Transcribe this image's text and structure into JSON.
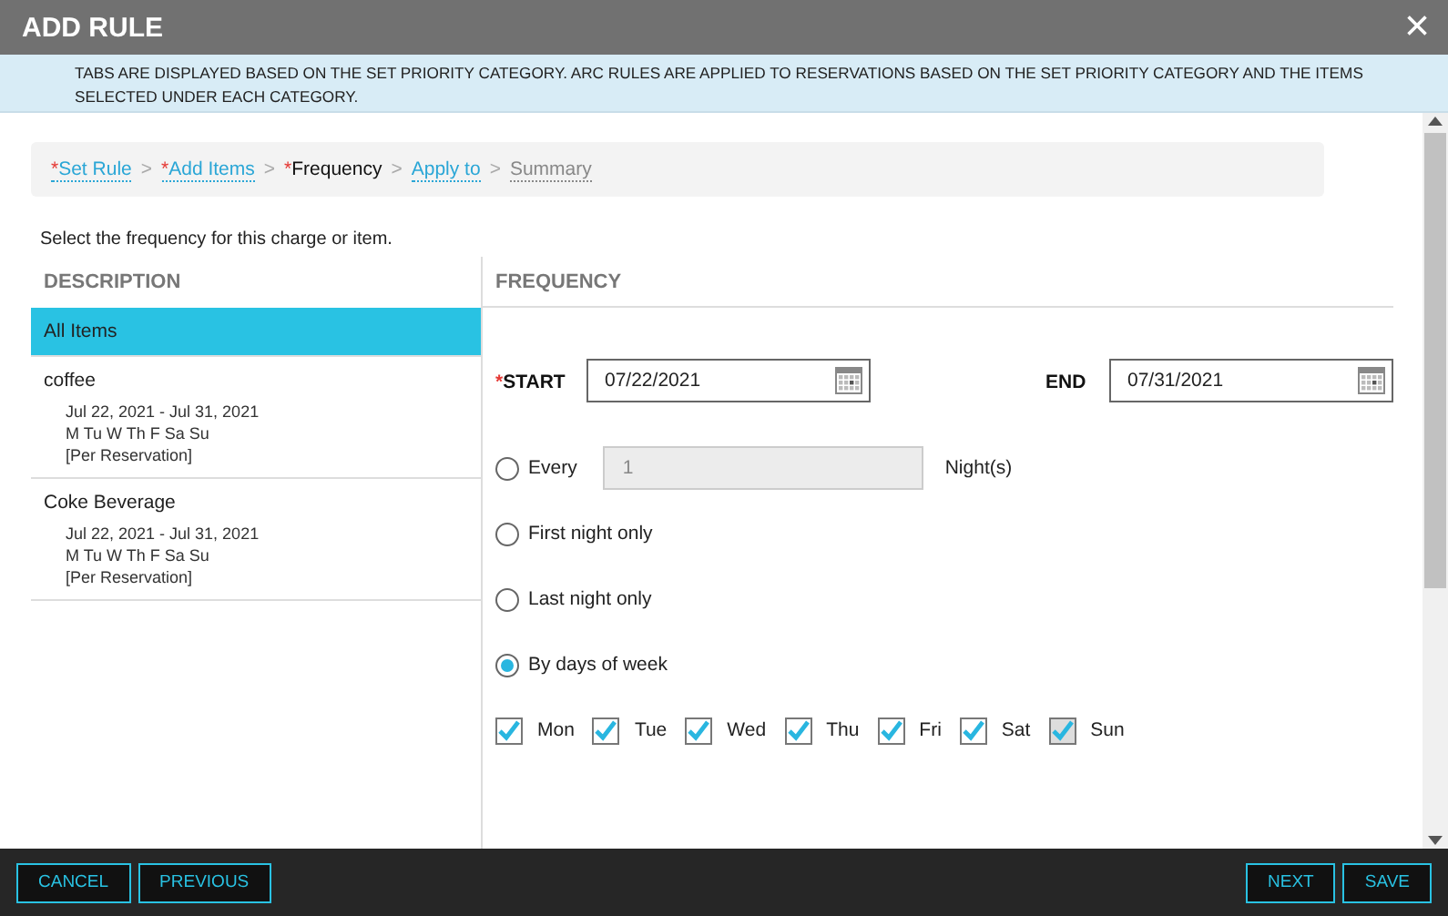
{
  "window": {
    "title": "ADD RULE",
    "close": "×"
  },
  "notice": "TABS ARE DISPLAYED BASED ON THE SET PRIORITY CATEGORY. ARC RULES ARE APPLIED TO RESERVATIONS BASED ON THE SET PRIORITY CATEGORY AND THE ITEMS SELECTED UNDER EACH CATEGORY.",
  "breadcrumb": [
    {
      "label": "Set Rule",
      "mark": "*",
      "kind": "link"
    },
    {
      "label": "Add Items",
      "mark": "*",
      "kind": "link"
    },
    {
      "label": "Frequency",
      "mark": "*",
      "kind": "current"
    },
    {
      "label": "Apply to",
      "kind": "link"
    },
    {
      "label": "Summary",
      "kind": "pending"
    }
  ],
  "separator": ">",
  "instruction": "Select the frequency for this charge or item.",
  "description": {
    "header": "DESCRIPTION",
    "items": [
      {
        "name": "All Items",
        "selected": true
      },
      {
        "name": "coffee",
        "selected": false,
        "dates": "Jul 22, 2021 - Jul 31, 2021",
        "days": "M Tu W Th F Sa Su",
        "basis": "[Per Reservation]"
      },
      {
        "name": "Coke Beverage",
        "selected": false,
        "dates": "Jul 22, 2021 - Jul 31, 2021",
        "days": "M Tu W Th F Sa Su",
        "basis": "[Per Reservation]"
      }
    ]
  },
  "frequency": {
    "header": "FREQUENCY",
    "start": {
      "label": "START",
      "mark": "*",
      "value": "07/22/2021"
    },
    "end": {
      "label": "END",
      "value": "07/31/2021"
    },
    "options": [
      {
        "kind": "every",
        "label": "Every",
        "selected": false,
        "value": "1",
        "unit": "Night(s)",
        "disabled": true
      },
      {
        "kind": "plain",
        "label": "First night only",
        "selected": false
      },
      {
        "kind": "plain",
        "label": "Last night only",
        "selected": false
      },
      {
        "kind": "plain",
        "label": "By days of week",
        "selected": true
      }
    ],
    "days": [
      {
        "label": "Mon",
        "checked": true,
        "disabled": false
      },
      {
        "label": "Tue",
        "checked": true,
        "disabled": false
      },
      {
        "label": "Wed",
        "checked": true,
        "disabled": false
      },
      {
        "label": "Thu",
        "checked": true,
        "disabled": false
      },
      {
        "label": "Fri",
        "checked": true,
        "disabled": false
      },
      {
        "label": "Sat",
        "checked": true,
        "disabled": false
      },
      {
        "label": "Sun",
        "checked": true,
        "disabled": true
      }
    ]
  },
  "footer": {
    "left": [
      "CANCEL",
      "PREVIOUS"
    ],
    "right": [
      "NEXT",
      "SAVE"
    ]
  }
}
